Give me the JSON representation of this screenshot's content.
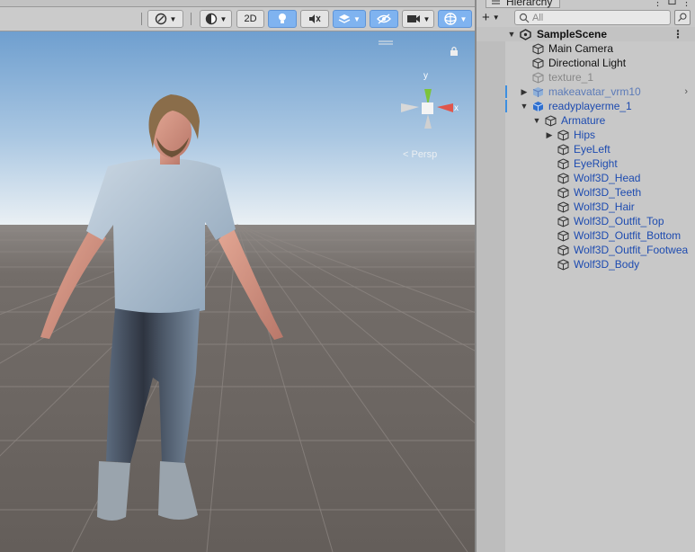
{
  "scene_view": {
    "toolbar": {
      "mode_2d": "2D",
      "icons": [
        "gizmo-orientation-icon",
        "shading-mode-icon",
        "2d-toggle",
        "lighting-icon",
        "audio-mute-icon",
        "effects-icon",
        "hidden-objects-icon",
        "camera-icon",
        "gizmos-icon"
      ]
    },
    "gizmo": {
      "x_label": "x",
      "y_label": "y",
      "projection_label": "< Persp"
    },
    "colors": {
      "sky_top": "#6f9fcf",
      "sky_horizon": "#e6eef4",
      "ground": "#6c6663",
      "grid": "#8a8480"
    }
  },
  "hierarchy": {
    "tab_title": "Hierarchy",
    "add_label": "+",
    "search_placeholder": "All",
    "scene_name": "SampleScene",
    "items": [
      {
        "label": "Main Camera"
      },
      {
        "label": "Directional Light"
      },
      {
        "label": "texture_1"
      },
      {
        "label": "makeavatar_vrm10"
      },
      {
        "label": "readyplayerme_1"
      },
      {
        "label": "Armature"
      },
      {
        "label": "Hips"
      },
      {
        "label": "EyeLeft"
      },
      {
        "label": "EyeRight"
      },
      {
        "label": "Wolf3D_Head"
      },
      {
        "label": "Wolf3D_Teeth"
      },
      {
        "label": "Wolf3D_Hair"
      },
      {
        "label": "Wolf3D_Outfit_Top"
      },
      {
        "label": "Wolf3D_Outfit_Bottom"
      },
      {
        "label": "Wolf3D_Outfit_Footwea"
      },
      {
        "label": "Wolf3D_Body"
      }
    ]
  }
}
